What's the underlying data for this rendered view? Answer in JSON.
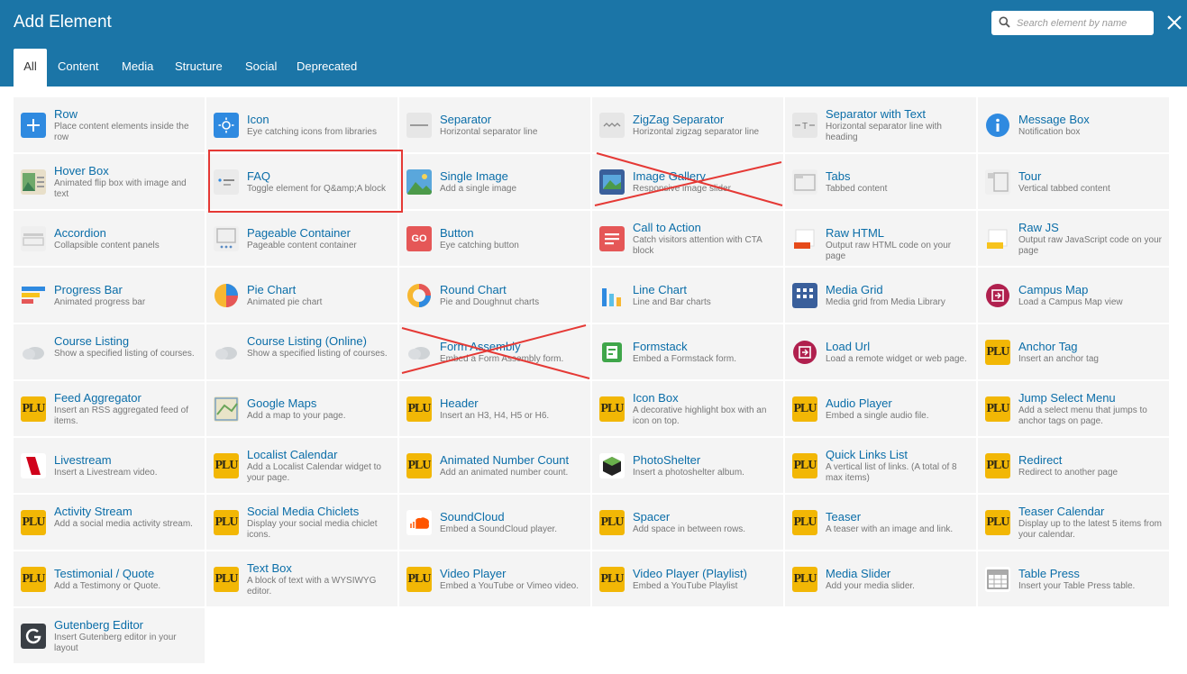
{
  "window": {
    "title": "Add Element"
  },
  "search": {
    "placeholder": "Search element by name"
  },
  "tabs": [
    {
      "label": "All",
      "active": true
    },
    {
      "label": "Content"
    },
    {
      "label": "Media"
    },
    {
      "label": "Structure"
    },
    {
      "label": "Social"
    },
    {
      "label": "Deprecated"
    }
  ],
  "elements": [
    {
      "name": "Row",
      "desc": "Place content elements inside the row",
      "icon": "plus-icon"
    },
    {
      "name": "Icon",
      "desc": "Eye catching icons from libraries",
      "icon": "sun-icon"
    },
    {
      "name": "Separator",
      "desc": "Horizontal separator line",
      "icon": "separator-icon"
    },
    {
      "name": "ZigZag Separator",
      "desc": "Horizontal zigzag separator line",
      "icon": "zigzag-icon"
    },
    {
      "name": "Separator with Text",
      "desc": "Horizontal separator line with heading",
      "icon": "separator-text-icon"
    },
    {
      "name": "Message Box",
      "desc": "Notification box",
      "icon": "info-icon"
    },
    {
      "name": "Hover Box",
      "desc": "Animated flip box with image and text",
      "icon": "hover-box-icon"
    },
    {
      "name": "FAQ",
      "desc": "Toggle element for Q&amp;A block",
      "icon": "faq-icon"
    },
    {
      "name": "Single Image",
      "desc": "Add a single image",
      "icon": "image-icon"
    },
    {
      "name": "Image Gallery",
      "desc": "Responsive image slider",
      "icon": "gallery-icon"
    },
    {
      "name": "Tabs",
      "desc": "Tabbed content",
      "icon": "tabs-icon"
    },
    {
      "name": "Tour",
      "desc": "Vertical tabbed content",
      "icon": "tour-icon"
    },
    {
      "name": "Accordion",
      "desc": "Collapsible content panels",
      "icon": "accordion-icon"
    },
    {
      "name": "Pageable Container",
      "desc": "Pageable content container",
      "icon": "pageable-icon"
    },
    {
      "name": "Button",
      "desc": "Eye catching button",
      "icon": "go-button-icon",
      "icon_text": "GO"
    },
    {
      "name": "Call to Action",
      "desc": "Catch visitors attention with CTA block",
      "icon": "cta-icon"
    },
    {
      "name": "Raw HTML",
      "desc": "Output raw HTML code on your page",
      "icon": "raw-html-icon"
    },
    {
      "name": "Raw JS",
      "desc": "Output raw JavaScript code on your page",
      "icon": "raw-js-icon"
    },
    {
      "name": "Progress Bar",
      "desc": "Animated progress bar",
      "icon": "progress-bar-icon"
    },
    {
      "name": "Pie Chart",
      "desc": "Animated pie chart",
      "icon": "pie-chart-icon"
    },
    {
      "name": "Round Chart",
      "desc": "Pie and Doughnut charts",
      "icon": "donut-chart-icon"
    },
    {
      "name": "Line Chart",
      "desc": "Line and Bar charts",
      "icon": "bar-chart-icon"
    },
    {
      "name": "Media Grid",
      "desc": "Media grid from Media Library",
      "icon": "grid-icon"
    },
    {
      "name": "Campus Map",
      "desc": "Load a Campus Map view",
      "icon": "campus-map-icon"
    },
    {
      "name": "Course Listing",
      "desc": "Show a specified listing of courses.",
      "icon": "cloud-icon"
    },
    {
      "name": "Course Listing (Online)",
      "desc": "Show a specified listing of courses.",
      "icon": "cloud-icon"
    },
    {
      "name": "Form Assembly",
      "desc": "Embed a Form Assembly form.",
      "icon": "cloud-icon"
    },
    {
      "name": "Formstack",
      "desc": "Embed a Formstack form.",
      "icon": "formstack-icon"
    },
    {
      "name": "Load Url",
      "desc": "Load a remote widget or web page.",
      "icon": "load-url-icon"
    },
    {
      "name": "Anchor Tag",
      "desc": "Insert an anchor tag",
      "icon": "plu-logo-icon"
    },
    {
      "name": "Feed Aggregator",
      "desc": "Insert an RSS aggregated feed of items.",
      "icon": "plu-logo-icon"
    },
    {
      "name": "Google Maps",
      "desc": "Add a map to your page.",
      "icon": "map-icon"
    },
    {
      "name": "Header",
      "desc": "Insert an H3, H4, H5 or H6.",
      "icon": "plu-logo-icon"
    },
    {
      "name": "Icon Box",
      "desc": "A decorative highlight box with an icon on top.",
      "icon": "plu-logo-icon"
    },
    {
      "name": "Audio Player",
      "desc": "Embed a single audio file.",
      "icon": "plu-logo-icon"
    },
    {
      "name": "Jump Select Menu",
      "desc": "Add a select menu that jumps to anchor tags on page.",
      "icon": "plu-logo-icon"
    },
    {
      "name": "Livestream",
      "desc": "Insert a Livestream video.",
      "icon": "livestream-icon"
    },
    {
      "name": "Localist Calendar",
      "desc": "Add a Localist Calendar widget to your page.",
      "icon": "plu-logo-icon"
    },
    {
      "name": "Animated Number Count",
      "desc": "Add an animated number count.",
      "icon": "plu-logo-icon"
    },
    {
      "name": "PhotoShelter",
      "desc": "Insert a photoshelter album.",
      "icon": "photoshelter-icon"
    },
    {
      "name": "Quick Links List",
      "desc": "A vertical list of links. (A total of 8 max items)",
      "icon": "plu-logo-icon"
    },
    {
      "name": "Redirect",
      "desc": "Redirect to another page",
      "icon": "plu-logo-icon"
    },
    {
      "name": "Activity Stream",
      "desc": "Add a social media activity stream.",
      "icon": "plu-logo-icon"
    },
    {
      "name": "Social Media Chiclets",
      "desc": "Display your social media chiclet icons.",
      "icon": "plu-logo-icon"
    },
    {
      "name": "SoundCloud",
      "desc": "Embed a SoundCloud player.",
      "icon": "soundcloud-icon"
    },
    {
      "name": "Spacer",
      "desc": "Add space in between rows.",
      "icon": "plu-logo-icon"
    },
    {
      "name": "Teaser",
      "desc": "A teaser with an image and link.",
      "icon": "plu-logo-icon"
    },
    {
      "name": "Teaser Calendar",
      "desc": "Display up to the latest 5 items from your calendar.",
      "icon": "plu-logo-icon"
    },
    {
      "name": "Testimonial / Quote",
      "desc": "Add a Testimony or Quote.",
      "icon": "plu-logo-icon"
    },
    {
      "name": "Text Box",
      "desc": "A block of text with a WYSIWYG editor.",
      "icon": "plu-logo-icon"
    },
    {
      "name": "Video Player",
      "desc": "Embed a YouTube or Vimeo video.",
      "icon": "plu-logo-icon"
    },
    {
      "name": "Video Player (Playlist)",
      "desc": "Embed a YouTube Playlist",
      "icon": "plu-logo-icon"
    },
    {
      "name": "Media Slider",
      "desc": "Add your media slider.",
      "icon": "plu-logo-icon"
    },
    {
      "name": "Table Press",
      "desc": "Insert your Table Press table.",
      "icon": "table-icon"
    },
    {
      "name": "Gutenberg Editor",
      "desc": "Insert Gutenberg editor in your layout",
      "icon": "gutenberg-icon"
    }
  ],
  "plu_logo_text": "PLU",
  "annotations": {
    "highlight_box_color": "#e53935",
    "highlighted": "FAQ",
    "crossed_out": [
      "Image Gallery",
      "Form Assembly"
    ]
  },
  "colors": {
    "header": "#1b75a7",
    "link": "#0a6da8",
    "cell_bg": "#f4f4f4",
    "annotation": "#e53935"
  }
}
